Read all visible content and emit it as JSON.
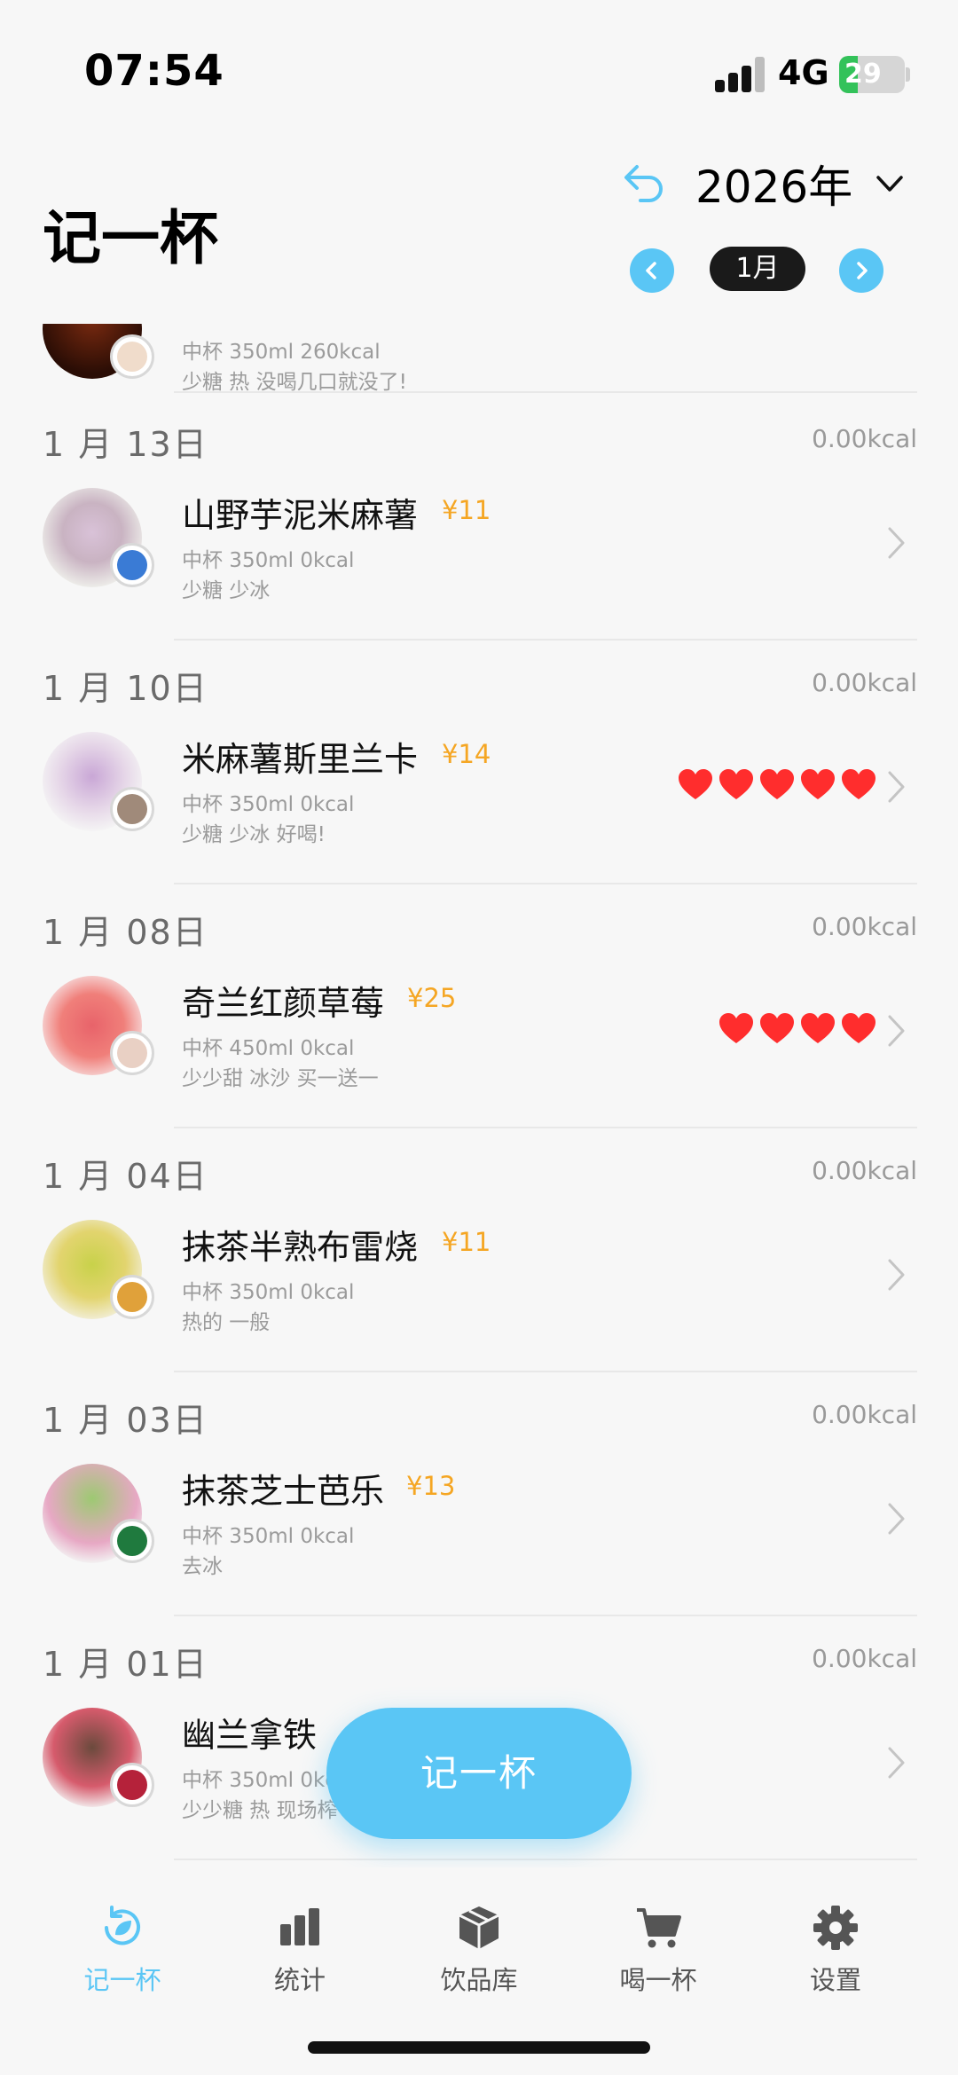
{
  "status_bar": {
    "time": "07:54",
    "network": "4G",
    "battery": "29",
    "battery_level": 0.29
  },
  "header": {
    "title": "记一杯",
    "year": "2026年",
    "month": "1月"
  },
  "partial_entry": {
    "spec": "中杯 350ml 260kcal",
    "note": "少糖 热 没喝几口就没了!"
  },
  "entries": [
    {
      "date": "1 月 13日",
      "kcal": "0.00kcal",
      "name": "山野芋泥米麻薯",
      "price": "¥11",
      "spec": "中杯 350ml  0kcal",
      "note": "少糖  少冰",
      "hearts": 0
    },
    {
      "date": "1 月 10日",
      "kcal": "0.00kcal",
      "name": "米麻薯斯里兰卡",
      "price": "¥14",
      "spec": "中杯 350ml  0kcal",
      "note": "少糖  少冰  好喝!",
      "hearts": 5
    },
    {
      "date": "1 月 08日",
      "kcal": "0.00kcal",
      "name": "奇兰红颜草莓",
      "price": "¥25",
      "spec": "中杯 450ml  0kcal",
      "note": "少少甜  冰沙  买一送一",
      "hearts": 4
    },
    {
      "date": "1 月 04日",
      "kcal": "0.00kcal",
      "name": "抹茶半熟布雷烧",
      "price": "¥11",
      "spec": "中杯 350ml  0kcal",
      "note": "热的 一般",
      "hearts": 0
    },
    {
      "date": "1 月 03日",
      "kcal": "0.00kcal",
      "name": "抹茶芝士芭乐",
      "price": "¥13",
      "spec": "中杯 350ml  0kcal",
      "note": "去冰",
      "hearts": 0
    },
    {
      "date": "1 月 01日",
      "kcal": "0.00kcal",
      "name": "幽兰拿铁",
      "price": "",
      "spec": "中杯 350ml  0kcal",
      "note": "少少糖  热  现场榨",
      "hearts": 0
    }
  ],
  "fab": {
    "label": "记一杯"
  },
  "tabs": [
    {
      "label": "记一杯",
      "icon": "record-icon",
      "active": true
    },
    {
      "label": "统计",
      "icon": "chart-icon",
      "active": false
    },
    {
      "label": "饮品库",
      "icon": "box-icon",
      "active": false
    },
    {
      "label": "喝一杯",
      "icon": "cart-icon",
      "active": false
    },
    {
      "label": "设置",
      "icon": "gear-icon",
      "active": false
    }
  ],
  "colors": {
    "accent": "#5ac6f5",
    "price": "#f5a623",
    "heart": "#ff2d2d",
    "battery": "#33c25a"
  }
}
